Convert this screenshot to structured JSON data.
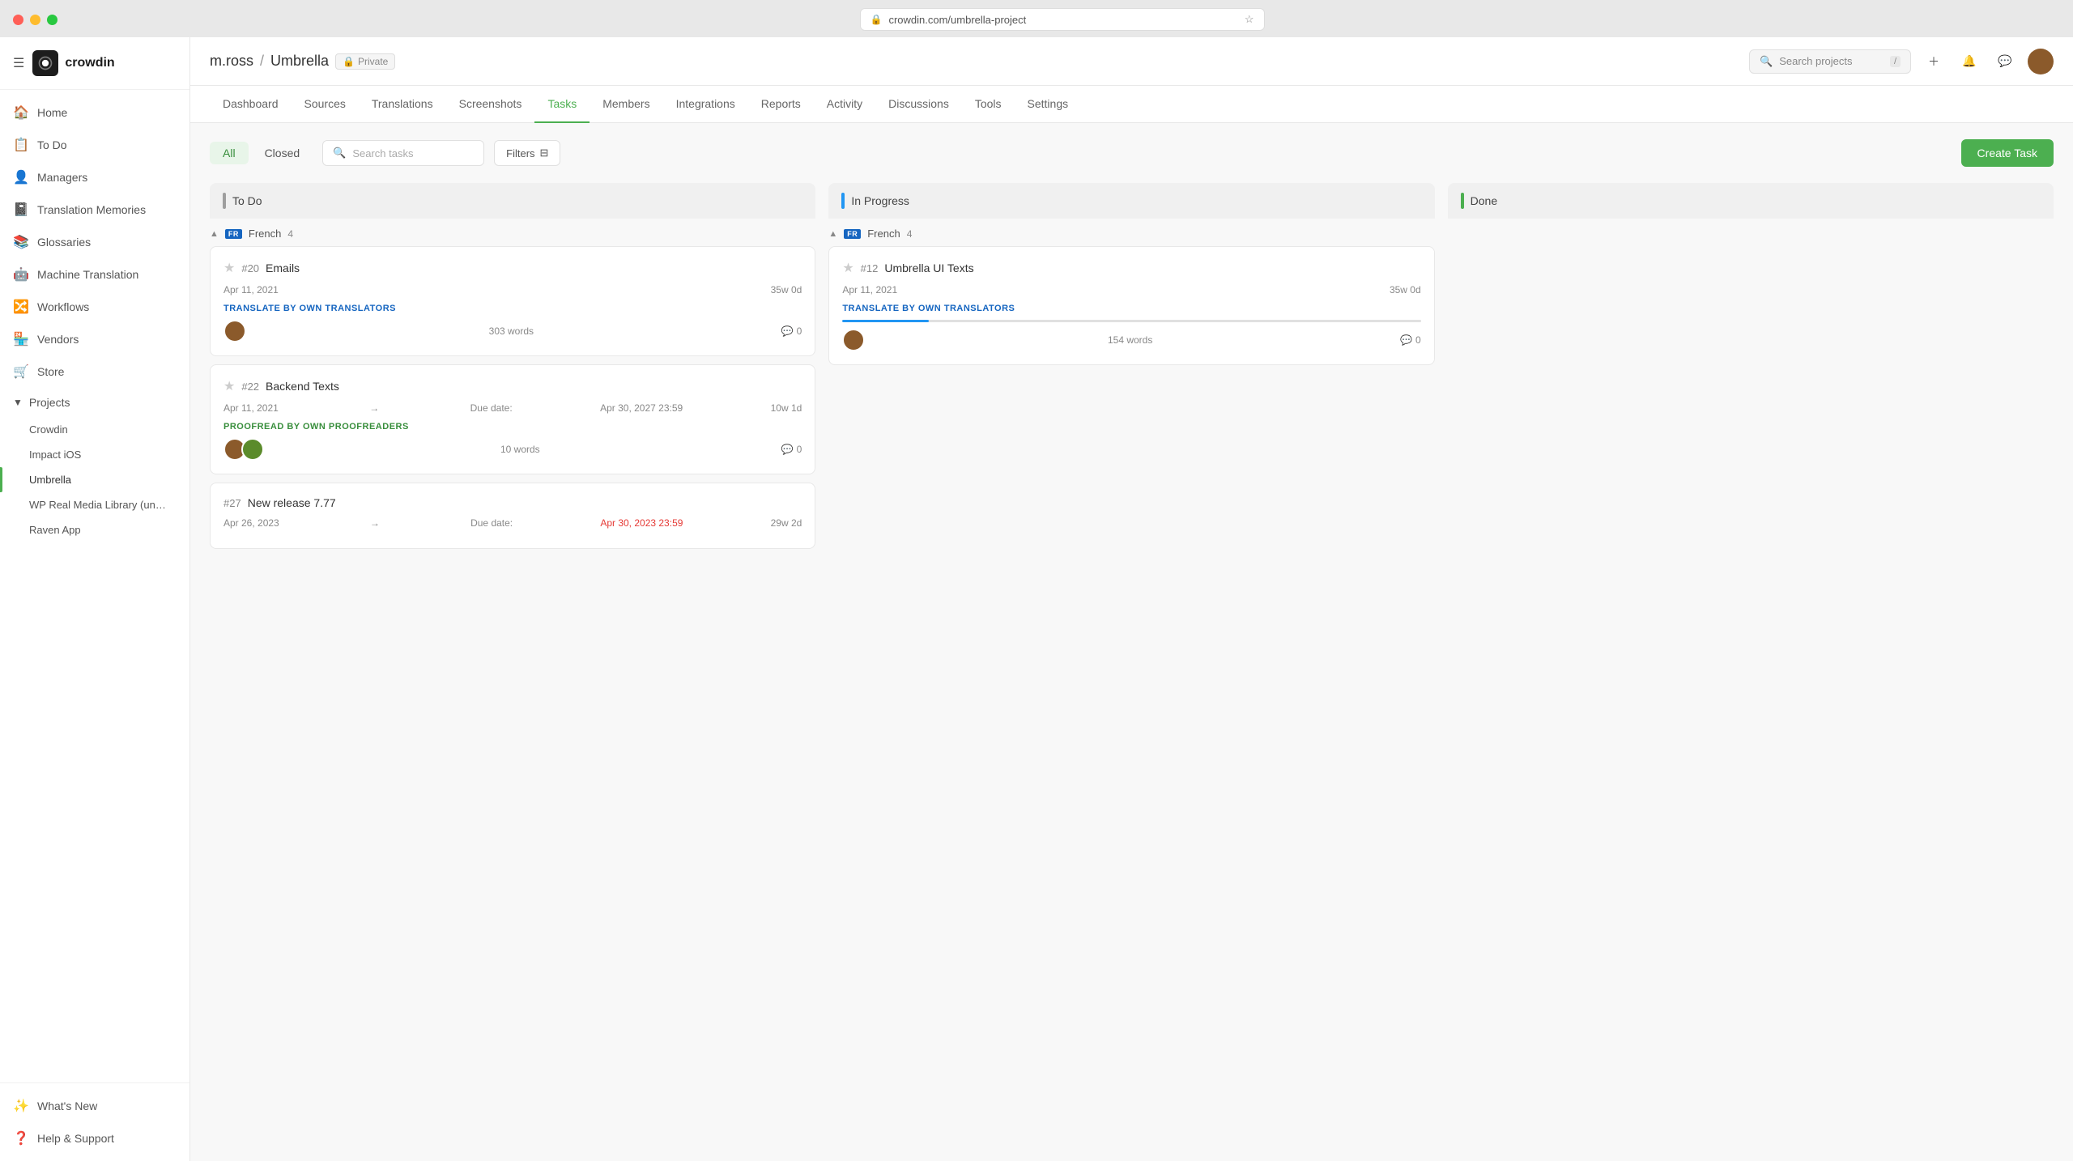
{
  "browser": {
    "url": "crowdin.com/umbrella-project",
    "favicon": "🔒"
  },
  "app": {
    "brand": "crowdin"
  },
  "sidebar": {
    "nav_items": [
      {
        "id": "home",
        "label": "Home",
        "icon": "🏠"
      },
      {
        "id": "todo",
        "label": "To Do",
        "icon": "📋"
      },
      {
        "id": "managers",
        "label": "Managers",
        "icon": "👤"
      },
      {
        "id": "translation-memories",
        "label": "Translation Memories",
        "icon": "📓"
      },
      {
        "id": "glossaries",
        "label": "Glossaries",
        "icon": "📚"
      },
      {
        "id": "machine-translation",
        "label": "Machine Translation",
        "icon": "🤖"
      },
      {
        "id": "workflows",
        "label": "Workflows",
        "icon": "🔀"
      },
      {
        "id": "vendors",
        "label": "Vendors",
        "icon": "🏪"
      },
      {
        "id": "store",
        "label": "Store",
        "icon": "🛒"
      }
    ],
    "projects_label": "Projects",
    "projects": [
      {
        "id": "crowdin",
        "label": "Crowdin",
        "active": false
      },
      {
        "id": "impact-ios",
        "label": "Impact iOS",
        "active": false
      },
      {
        "id": "umbrella",
        "label": "Umbrella",
        "active": true
      },
      {
        "id": "wp-real-media",
        "label": "WP Real Media Library (un…",
        "active": false
      },
      {
        "id": "raven-app",
        "label": "Raven App",
        "active": false
      }
    ],
    "bottom_nav": [
      {
        "id": "whats-new",
        "label": "What's New",
        "icon": "✨"
      },
      {
        "id": "help-support",
        "label": "Help & Support",
        "icon": "❓"
      }
    ]
  },
  "header": {
    "project_owner": "m.ross",
    "project_name": "Umbrella",
    "privacy": "Private",
    "search_placeholder": "Search projects",
    "search_shortcut": "/"
  },
  "tabs": [
    {
      "id": "dashboard",
      "label": "Dashboard"
    },
    {
      "id": "sources",
      "label": "Sources"
    },
    {
      "id": "translations",
      "label": "Translations"
    },
    {
      "id": "screenshots",
      "label": "Screenshots"
    },
    {
      "id": "tasks",
      "label": "Tasks",
      "active": true
    },
    {
      "id": "members",
      "label": "Members"
    },
    {
      "id": "integrations",
      "label": "Integrations"
    },
    {
      "id": "reports",
      "label": "Reports"
    },
    {
      "id": "activity",
      "label": "Activity"
    },
    {
      "id": "discussions",
      "label": "Discussions"
    },
    {
      "id": "tools",
      "label": "Tools"
    },
    {
      "id": "settings",
      "label": "Settings"
    }
  ],
  "tasks": {
    "status_tabs": [
      {
        "id": "all",
        "label": "All",
        "active": true
      },
      {
        "id": "closed",
        "label": "Closed",
        "active": false
      }
    ],
    "search_placeholder": "Search tasks",
    "filters_label": "Filters",
    "create_task_label": "Create Task",
    "columns": [
      {
        "id": "todo",
        "label": "To Do"
      },
      {
        "id": "inprogress",
        "label": "In Progress"
      },
      {
        "id": "done",
        "label": "Done"
      }
    ],
    "language_group": {
      "code": "FR",
      "name": "French",
      "count": 4
    },
    "todo_cards": [
      {
        "id": "20",
        "title": "Emails",
        "date": "Apr 11, 2021",
        "duration": "35w 0d",
        "due_date": null,
        "type_label": "TRANSLATE BY OWN TRANSLATORS",
        "type": "translate",
        "word_count": "303 words",
        "progress": 0,
        "comments": 0,
        "avatars": 1
      },
      {
        "id": "22",
        "title": "Backend Texts",
        "date": "Apr 11, 2021",
        "duration": "10w 1d",
        "due_date": "Apr 30, 2027 23:59",
        "due_overdue": false,
        "type_label": "PROOFREAD BY OWN PROOFREADERS",
        "type": "proofread",
        "word_count": "10 words",
        "progress": 0,
        "comments": 0,
        "avatars": 2
      },
      {
        "id": "27",
        "title": "New release 7.77",
        "date": "Apr 26, 2023",
        "duration": "29w 2d",
        "due_date": "Apr 30, 2023 23:59",
        "due_overdue": true,
        "type_label": "",
        "type": "",
        "word_count": "",
        "progress": 0,
        "comments": 0,
        "avatars": 0
      }
    ],
    "inprogress_cards": [
      {
        "id": "12",
        "title": "Umbrella UI Texts",
        "date": "Apr 11, 2021",
        "duration": "35w 0d",
        "due_date": null,
        "type_label": "TRANSLATE BY OWN TRANSLATORS",
        "type": "translate",
        "word_count": "154 words",
        "progress": 15,
        "comments": 0,
        "avatars": 1
      }
    ]
  }
}
